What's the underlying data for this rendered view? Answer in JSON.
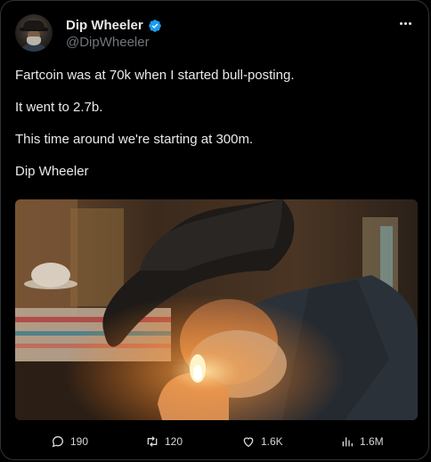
{
  "author": {
    "display_name": "Dip Wheeler",
    "handle": "@DipWheeler",
    "verified_color": "#1d9bf0"
  },
  "tweet": {
    "paragraphs": [
      "Fartcoin was at 70k when I started bull-posting.",
      "It went to 2.7b.",
      "This time around we're starting at 300m.",
      "Dip Wheeler"
    ]
  },
  "metrics": {
    "replies": "190",
    "retweets": "120",
    "likes": "1.6K",
    "views": "1.6M"
  },
  "icons": {
    "avatar": "avatar",
    "verified": "verified-badge-icon",
    "more": "more-options-icon",
    "reply": "reply-icon",
    "retweet": "retweet-icon",
    "like": "heart-icon",
    "views": "analytics-icon"
  }
}
